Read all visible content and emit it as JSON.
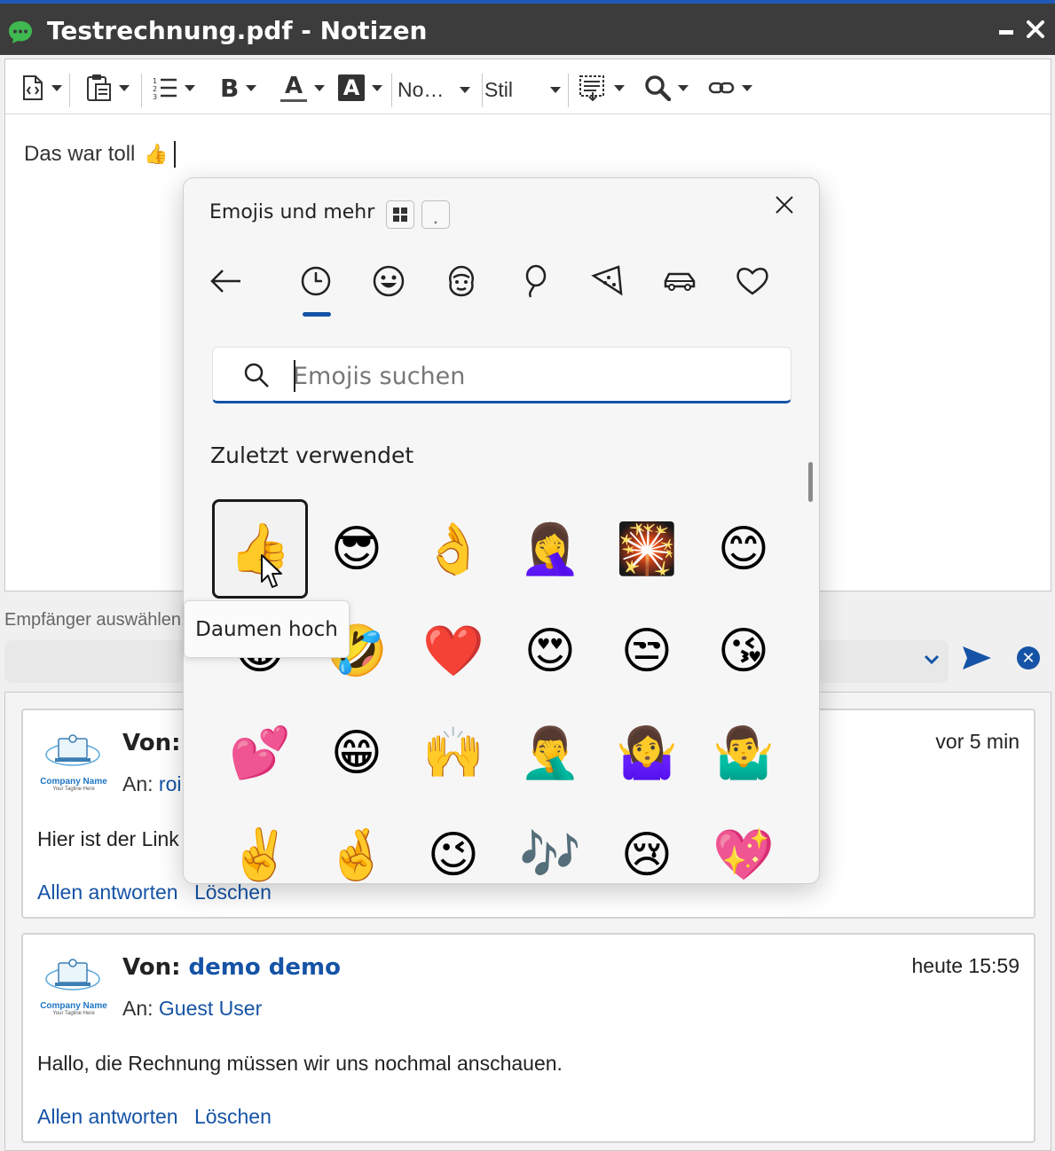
{
  "window": {
    "title": "Testrechnung.pdf - Notizen",
    "minimize_glyph": "–",
    "close_glyph": "✕"
  },
  "toolbar": {
    "font_name": "No…",
    "style_name": "Stil",
    "items": [
      {
        "name": "source-icon"
      },
      {
        "name": "clipboard-icon"
      },
      {
        "name": "list-icon"
      },
      {
        "name": "bold-icon",
        "label": "B"
      },
      {
        "name": "font-color-icon",
        "label": "A"
      },
      {
        "name": "highlight-color-icon",
        "label": "A"
      },
      {
        "name": "table-icon"
      },
      {
        "name": "find-icon"
      },
      {
        "name": "link-icon"
      }
    ]
  },
  "editor": {
    "text": "Das war toll",
    "emoji": "👍"
  },
  "recipient": {
    "label": "Empfänger auswählen:",
    "value": "",
    "clear_glyph": "✕"
  },
  "notes": [
    {
      "from_label": "Von:",
      "from_name": "",
      "to_label": "An:",
      "to_name": "roi",
      "time": "vor 5 min",
      "body": "Hier ist der Link",
      "actions": [
        "Allen antworten",
        "Löschen"
      ],
      "logo_text": "Company Name",
      "logo_tagline": "Your Tagline Here"
    },
    {
      "from_label": "Von:",
      "from_name": "demo demo",
      "to_label": "An:",
      "to_name": "Guest User",
      "time": "heute 15:59",
      "body": "Hallo, die Rechnung müssen wir uns nochmal anschauen.",
      "actions": [
        "Allen antworten",
        "Löschen"
      ],
      "logo_text": "Company Name",
      "logo_tagline": "Your Tagline Here"
    }
  ],
  "emoji_panel": {
    "title": "Emojis und mehr",
    "mini_button_2": "˳",
    "tabs": [
      "back-arrow-icon",
      "recent-clock-icon",
      "smiley-icon",
      "people-icon",
      "balloon-icon",
      "food-icon",
      "car-icon",
      "heart-icon"
    ],
    "search_placeholder": "Emojis suchen",
    "section": "Zuletzt verwendet",
    "tooltip": "Daumen hoch",
    "emojis": [
      "👍",
      "😎",
      "👌",
      "🤦‍♀️",
      "🎇",
      "😊",
      "😂",
      "🤣",
      "❤️",
      "😍",
      "😒",
      "😘",
      "💕",
      "😁",
      "🙌",
      "🤦‍♂️",
      "🤷‍♀️",
      "🤷‍♂️",
      "✌️",
      "🤞",
      "😉",
      "🎶",
      "😢",
      "💖"
    ]
  },
  "colors": {
    "accent": "#1553a6",
    "titlebar": "#3c3c3c",
    "titlebar_border": "#1e5bb8"
  }
}
